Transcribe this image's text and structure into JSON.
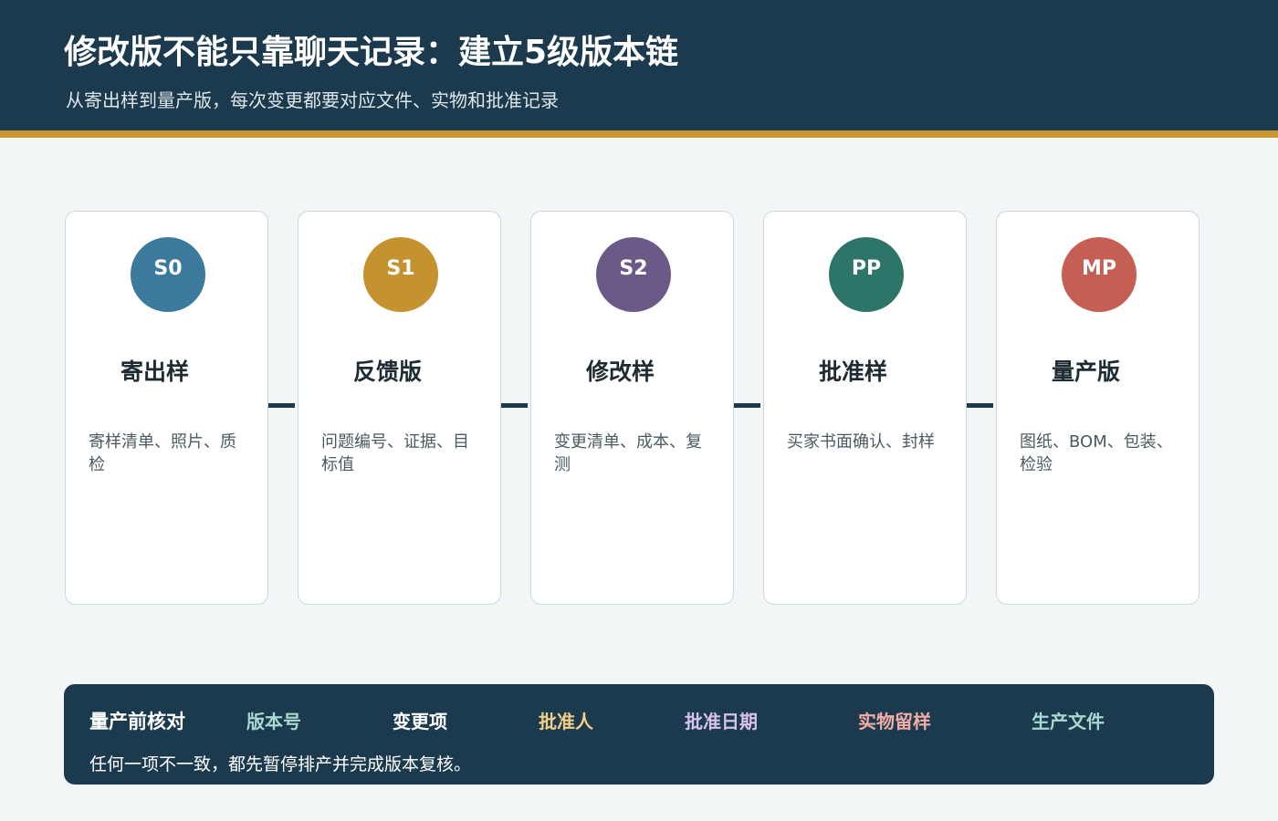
{
  "header": {
    "title": "修改版不能只靠聊天记录：建立5级版本链",
    "subtitle": "从寄出样到量产版，每次变更都要对应文件、实物和批准记录"
  },
  "stages": [
    {
      "code": "S0",
      "name": "寄出样",
      "desc": "寄样清单、照片、质检",
      "color": "#3b7a9c"
    },
    {
      "code": "S1",
      "name": "反馈版",
      "desc": "问题编号、证据、目标值",
      "color": "#c4922f"
    },
    {
      "code": "S2",
      "name": "修改样",
      "desc": "变更清单、成本、复测",
      "color": "#6b5a88"
    },
    {
      "code": "PP",
      "name": "批准样",
      "desc": "买家书面确认、封样",
      "color": "#2d7568"
    },
    {
      "code": "MP",
      "name": "量产版",
      "desc": "图纸、BOM、包装、检验",
      "color": "#c65f53"
    }
  ],
  "footer": {
    "title": "量产前核对",
    "checks": [
      {
        "label": "版本号",
        "color": "#a9d8d0"
      },
      {
        "label": "变更项",
        "color": "#ffffff"
      },
      {
        "label": "批准人",
        "color": "#f1cf86"
      },
      {
        "label": "批准日期",
        "color": "#d7c2ee"
      },
      {
        "label": "实物留样",
        "color": "#f2ada4"
      },
      {
        "label": "生产文件",
        "color": "#a9d8d0"
      }
    ],
    "note": "任何一项不一致，都先暂停排产并完成版本复核。"
  }
}
